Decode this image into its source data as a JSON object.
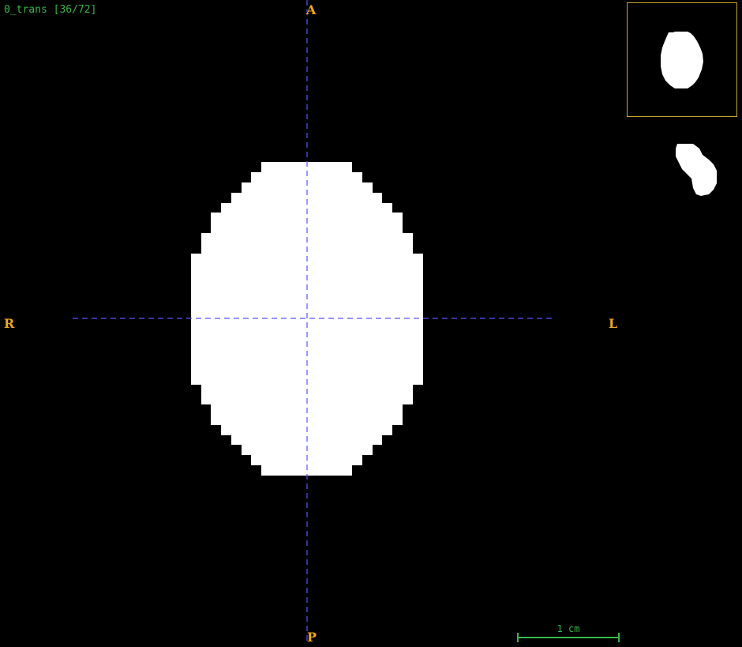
{
  "viewer": {
    "series_label": "0_trans [36/72]",
    "orientation": {
      "anterior": "A",
      "posterior": "P",
      "right": "R",
      "left": "L"
    },
    "scale_bar": {
      "label": "1 cm"
    },
    "colors": {
      "background": "#000000",
      "mask": "#ffffff",
      "crosshair": "#5555ff",
      "orientation_label": "#f3a61b",
      "overlay_text": "#39b54a",
      "thumbnail_border": "#c8a62a"
    },
    "icons": {
      "crosshair": "crosshair-icon",
      "thumbnail": "navigator-thumbnail"
    }
  }
}
